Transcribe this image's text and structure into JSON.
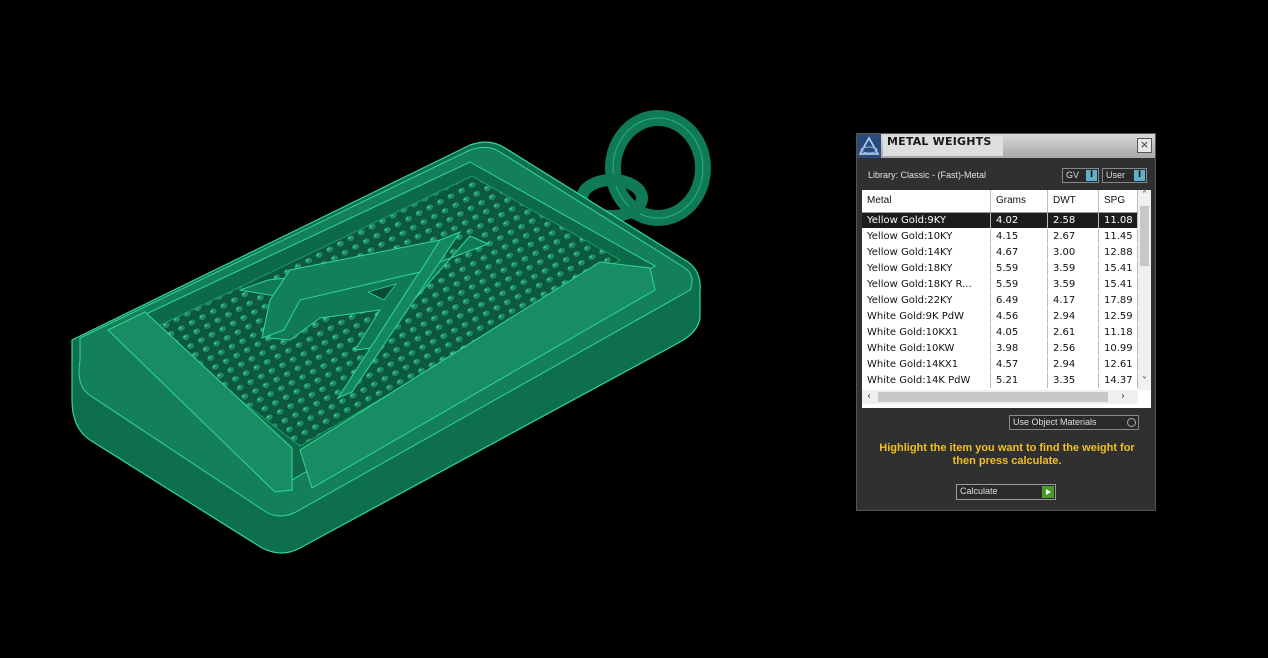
{
  "panel": {
    "title": "METAL WEIGHTS",
    "close_label": "×",
    "library_label": "Library: Classic - (Fast)-Metal",
    "toggle_gv_label": "GV",
    "toggle_user_label": "User",
    "toggle_indicator": "I"
  },
  "table": {
    "headers": [
      "Metal",
      "Grams",
      "DWT",
      "SPG"
    ],
    "rows": [
      {
        "metal": "Yellow Gold:9KY",
        "grams": "4.02",
        "dwt": "2.58",
        "spg": "11.08"
      },
      {
        "metal": "Yellow Gold:10KY",
        "grams": "4.15",
        "dwt": "2.67",
        "spg": "11.45"
      },
      {
        "metal": "Yellow Gold:14KY",
        "grams": "4.67",
        "dwt": "3.00",
        "spg": "12.88"
      },
      {
        "metal": "Yellow Gold:18KY",
        "grams": "5.59",
        "dwt": "3.59",
        "spg": "15.41"
      },
      {
        "metal": "Yellow Gold:18KY R...",
        "grams": "5.59",
        "dwt": "3.59",
        "spg": "15.41"
      },
      {
        "metal": "Yellow Gold:22KY",
        "grams": "6.49",
        "dwt": "4.17",
        "spg": "17.89"
      },
      {
        "metal": "White Gold:9K PdW",
        "grams": "4.56",
        "dwt": "2.94",
        "spg": "12.59"
      },
      {
        "metal": "White Gold:10KX1",
        "grams": "4.05",
        "dwt": "2.61",
        "spg": "11.18"
      },
      {
        "metal": "White Gold:10KW",
        "grams": "3.98",
        "dwt": "2.56",
        "spg": "10.99"
      },
      {
        "metal": "White Gold:14KX1",
        "grams": "4.57",
        "dwt": "2.94",
        "spg": "12.61"
      },
      {
        "metal": "White Gold:14K PdW",
        "grams": "5.21",
        "dwt": "3.35",
        "spg": "14.37"
      }
    ],
    "selected_row": 0
  },
  "use_object_materials_label": "Use Object Materials",
  "instruction": "Highlight the item you want to find the weight for then press calculate.",
  "calculate_label": "Calculate",
  "colors": {
    "model_green": "#0f7a55",
    "model_edge": "#2fd79a",
    "instruction_text": "#f0c020",
    "panel_bg": "#303030"
  },
  "icons": {
    "logo": "app-logo-icon",
    "close": "close-icon",
    "scroll_up": "chevron-up-icon",
    "scroll_down": "chevron-down-icon",
    "scroll_left": "chevron-left-icon",
    "scroll_right": "chevron-right-icon",
    "go": "play-arrow-icon"
  }
}
